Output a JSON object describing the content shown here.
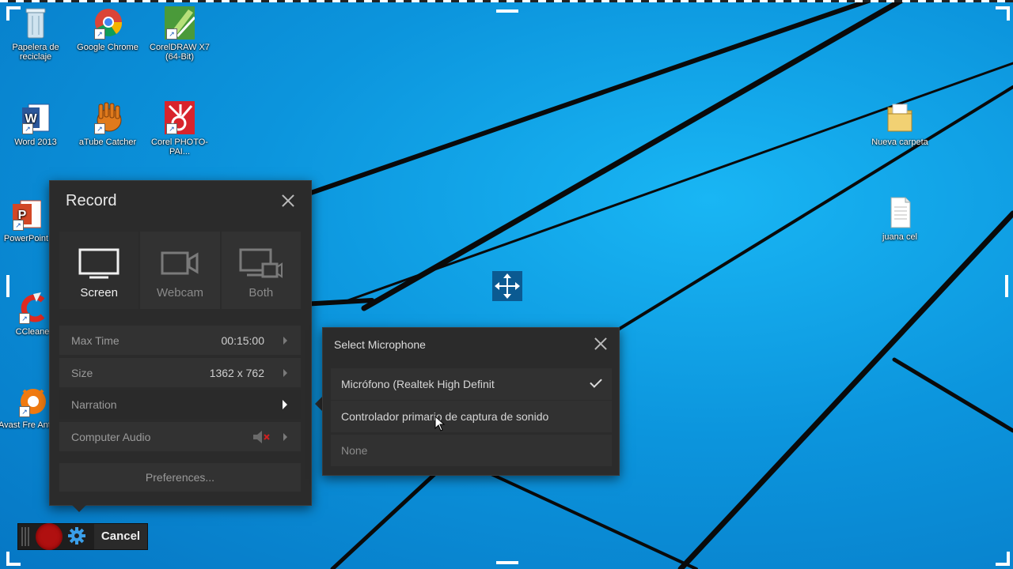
{
  "desktop": {
    "icons": [
      {
        "label": "Papelera de reciclaje",
        "icon": "recycle-bin-icon"
      },
      {
        "label": "Google Chrome",
        "icon": "chrome-icon"
      },
      {
        "label": "CorelDRAW X7 (64-Bit)",
        "icon": "coreldraw-icon"
      },
      {
        "label": "Word 2013",
        "icon": "word-icon"
      },
      {
        "label": "aTube Catcher",
        "icon": "atube-catcher-icon"
      },
      {
        "label": "Corel PHOTO-PAI...",
        "icon": "corel-photo-paint-icon"
      },
      {
        "label": "PowerPoint",
        "icon": "powerpoint-icon"
      },
      {
        "label": "CCleane",
        "icon": "ccleaner-icon"
      },
      {
        "label": "Avast Fre Antiviru",
        "icon": "avast-icon"
      },
      {
        "label": "Nueva carpeta",
        "icon": "folder-icon"
      },
      {
        "label": "juana cel",
        "icon": "text-file-icon"
      }
    ]
  },
  "record": {
    "title": "Record",
    "modes": [
      {
        "label": "Screen",
        "icon": "monitor-icon",
        "active": true
      },
      {
        "label": "Webcam",
        "icon": "webcam-icon",
        "active": false
      },
      {
        "label": "Both",
        "icon": "screen-and-webcam-icon",
        "active": false
      }
    ],
    "options": [
      {
        "label": "Max Time",
        "value": "00:15:00"
      },
      {
        "label": "Size",
        "value": "1362 x 762"
      },
      {
        "label": "Narration",
        "value": ""
      },
      {
        "label": "Computer Audio",
        "value": "",
        "icon": "speaker-muted-icon"
      }
    ],
    "preferences_label": "Preferences..."
  },
  "microphone": {
    "title": "Select Microphone",
    "options": [
      {
        "label": "Micrófono (Realtek High Definit",
        "selected": true
      },
      {
        "label": "Controlador primario de captura de sonido",
        "selected": false
      },
      {
        "label": "None",
        "selected": false
      }
    ]
  },
  "toolbar": {
    "cancel_label": "Cancel"
  },
  "colors": {
    "panel_bg": "#2b2b2b",
    "record_red": "#b01010",
    "gear_blue": "#3a9ee8",
    "desktop_blue": "#0c95dd"
  }
}
